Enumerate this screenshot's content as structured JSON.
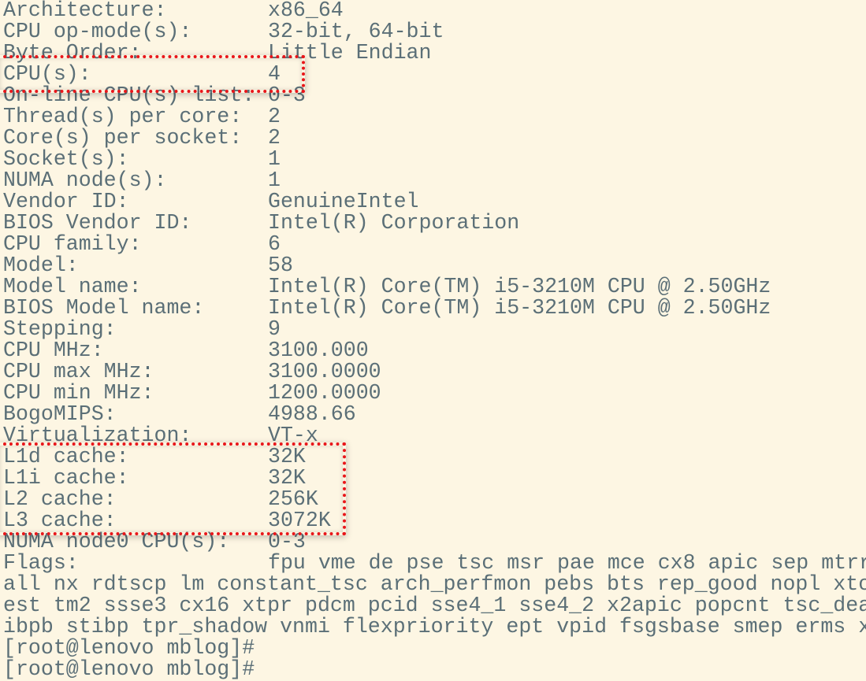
{
  "terminal": {
    "rows": [
      {
        "label": "Architecture:",
        "value": "x86_64"
      },
      {
        "label": "CPU op-mode(s):",
        "value": "32-bit, 64-bit"
      },
      {
        "label": "Byte Order:",
        "value": "Little Endian"
      },
      {
        "label": "CPU(s):",
        "value": "4"
      },
      {
        "label": "On-line CPU(s) list:",
        "value": "0-3"
      },
      {
        "label": "Thread(s) per core:",
        "value": "2"
      },
      {
        "label": "Core(s) per socket:",
        "value": "2"
      },
      {
        "label": "Socket(s):",
        "value": "1"
      },
      {
        "label": "NUMA node(s):",
        "value": "1"
      },
      {
        "label": "Vendor ID:",
        "value": "GenuineIntel"
      },
      {
        "label": "BIOS Vendor ID:",
        "value": "Intel(R) Corporation"
      },
      {
        "label": "CPU family:",
        "value": "6"
      },
      {
        "label": "Model:",
        "value": "58"
      },
      {
        "label": "Model name:",
        "value": "Intel(R) Core(TM) i5-3210M CPU @ 2.50GHz"
      },
      {
        "label": "BIOS Model name:",
        "value": "Intel(R) Core(TM) i5-3210M CPU @ 2.50GHz"
      },
      {
        "label": "Stepping:",
        "value": "9"
      },
      {
        "label": "CPU MHz:",
        "value": "3100.000"
      },
      {
        "label": "CPU max MHz:",
        "value": "3100.0000"
      },
      {
        "label": "CPU min MHz:",
        "value": "1200.0000"
      },
      {
        "label": "BogoMIPS:",
        "value": "4988.66"
      },
      {
        "label": "Virtualization:",
        "value": "VT-x"
      },
      {
        "label": "L1d cache:",
        "value": "32K"
      },
      {
        "label": "L1i cache:",
        "value": "32K"
      },
      {
        "label": "L2 cache:",
        "value": "256K"
      },
      {
        "label": "L3 cache:",
        "value": "3072K"
      },
      {
        "label": "NUMA node0 CPU(s):",
        "value": "0-3"
      },
      {
        "label": "Flags:",
        "value": "fpu vme de pse tsc msr pae mce cx8 apic sep mtrr"
      }
    ],
    "continuation_lines": [
      "all nx rdtscp lm constant_tsc arch_perfmon pebs bts rep_good nopl xto",
      "est tm2 ssse3 cx16 xtpr pdcm pcid sse4_1 sse4_2 x2apic popcnt tsc_dea",
      "ibpb stibp tpr_shadow vnmi flexpriority ept vpid fsgsbase smep erms x",
      "[root@lenovo mblog]#",
      "[root@lenovo mblog]#"
    ]
  },
  "colors": {
    "background": "#fdf6e3",
    "text": "#5b6f77",
    "highlight_box": "#e8161a"
  }
}
